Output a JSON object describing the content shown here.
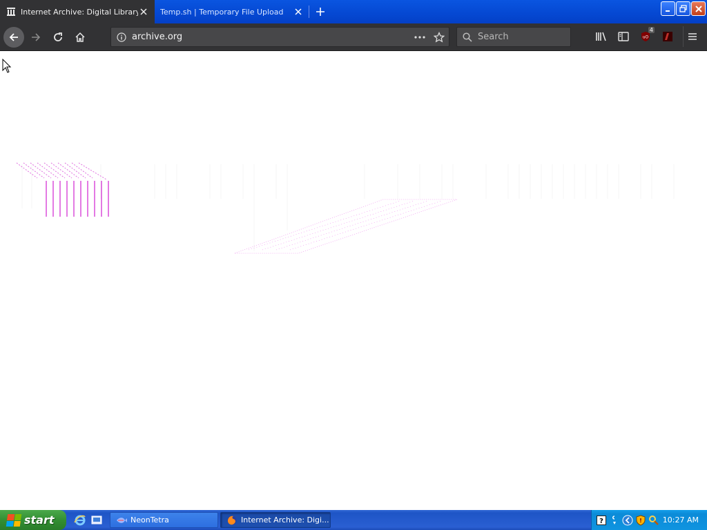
{
  "browser": {
    "tabs": [
      {
        "label": "Internet Archive: Digital Library of Free & Borrowable Books, Movies, Music & Wayback Machine",
        "icon": "archive-icon",
        "active": true
      },
      {
        "label": "Temp.sh | Temporary File Upload",
        "icon": "none",
        "active": false
      }
    ],
    "new_tab_icon": "plus-icon",
    "window_controls": [
      "minimize-icon",
      "restore-icon",
      "close-icon"
    ],
    "nav": {
      "back_icon": "arrow-left-icon",
      "forward_icon": "arrow-right-icon",
      "reload_icon": "reload-icon",
      "home_icon": "home-icon"
    },
    "address": {
      "url": "archive.org",
      "page_actions_icon": "more-icon",
      "bookmark_icon": "star-icon"
    },
    "search": {
      "placeholder": "Search"
    },
    "toolbar_right": {
      "library_icon": "library-icon",
      "sidebar_icon": "sidebar-icon",
      "ublock_badge": "4",
      "menu_icon": "hamburger-menu-icon"
    }
  },
  "taskbar": {
    "start_label": "start",
    "buttons": [
      {
        "label": "NeonTetra",
        "active": false
      },
      {
        "label": "Internet Archive: Digi...",
        "active": true
      }
    ],
    "clock": "10:27 AM"
  }
}
